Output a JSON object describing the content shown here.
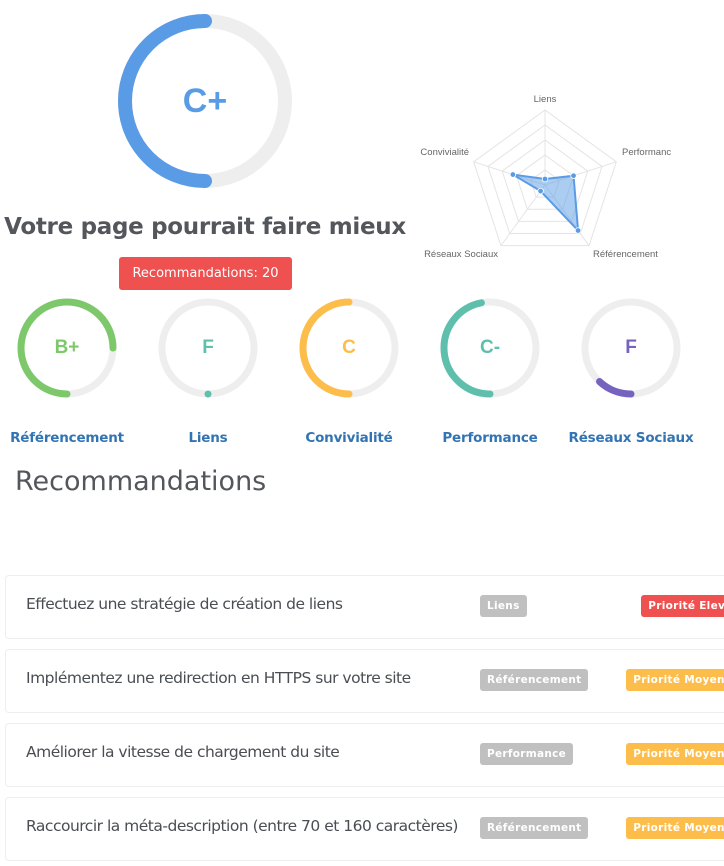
{
  "overall": {
    "grade": "C+",
    "score": 0.5,
    "color": "#5a9be6",
    "track_color": "#eeeeee",
    "headline": "Votre page pourrait faire mieux",
    "recommendations_badge": "Recommandations: 20",
    "badge_color": "#ef5050"
  },
  "chart_data": {
    "type": "radar",
    "axes": [
      "Liens",
      "Performanc",
      "Référencement",
      "Réseaux Sociaux",
      "Convivialité"
    ],
    "series": [
      {
        "name": "Score",
        "values": [
          8,
          40,
          75,
          10,
          45
        ],
        "color": "#5a9be6"
      }
    ],
    "range": [
      0,
      100
    ],
    "grid_levels": 5,
    "legend": "none"
  },
  "categories": [
    {
      "name": "Référencement",
      "grade": "B+",
      "score": 0.75,
      "color": "#7dc86a"
    },
    {
      "name": "Liens",
      "grade": "F",
      "score": 0.0,
      "color": "#5fbfad"
    },
    {
      "name": "Convivialité",
      "grade": "C",
      "score": 0.5,
      "color": "#fdbd4b"
    },
    {
      "name": "Performance",
      "grade": "C-",
      "score": 0.47,
      "color": "#5fbfad"
    },
    {
      "name": "Réseaux Sociaux",
      "grade": "F",
      "score": 0.12,
      "color": "#7563bf"
    }
  ],
  "recommendations_section": {
    "title": "Recommandations",
    "items": [
      {
        "text": "Effectuez une stratégie de création de liens",
        "category": "Liens",
        "priority": "Priorité Elevée",
        "priority_color": "#ef5050"
      },
      {
        "text": "Implémentez une redirection en HTTPS sur votre site",
        "category": "Référencement",
        "priority": "Priorité Moyenne",
        "priority_color": "#fdbd4b"
      },
      {
        "text": "Améliorer la vitesse de chargement du site",
        "category": "Performance",
        "priority": "Priorité Moyenne",
        "priority_color": "#fdbd4b"
      },
      {
        "text": "Raccourcir la méta-description (entre 70 et 160 caractères)",
        "category": "Référencement",
        "priority": "Priorité Moyenne",
        "priority_color": "#fdbd4b"
      }
    ]
  }
}
